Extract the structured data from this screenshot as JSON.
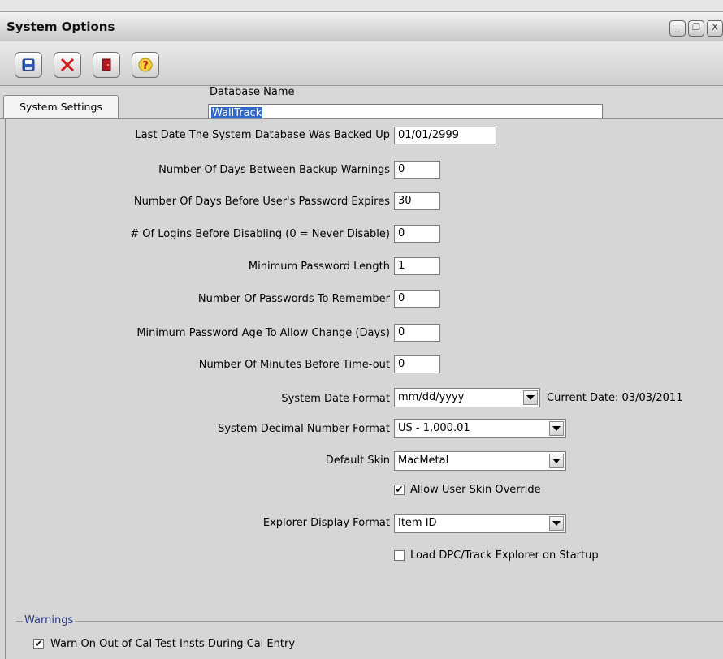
{
  "window": {
    "title": "System Options",
    "controls": [
      "_",
      "❐",
      "X"
    ]
  },
  "toolbar": {
    "buttons": [
      {
        "name": "save",
        "icon": "save-icon"
      },
      {
        "name": "cancel",
        "icon": "close-icon"
      },
      {
        "name": "exit",
        "icon": "door-exit-icon"
      },
      {
        "name": "help",
        "icon": "help-icon"
      }
    ],
    "database_name_label": "Database Name",
    "database_name_value": "WallTrack"
  },
  "tabs": [
    {
      "label": "System Settings",
      "selected": true
    }
  ],
  "settings": {
    "last_backup": {
      "label": "Last Date The System Database Was Backed Up",
      "value": "01/01/2999"
    },
    "backup_warning_days": {
      "label": "Number Of Days Between Backup Warnings",
      "value": "0"
    },
    "password_expire_days": {
      "label": "Number Of Days Before User's Password Expires",
      "value": "30"
    },
    "logins_before_disable": {
      "label": "# Of Logins Before Disabling (0 = Never Disable)",
      "value": "0"
    },
    "min_password_length": {
      "label": "Minimum Password Length",
      "value": "1"
    },
    "passwords_remember": {
      "label": "Number Of Passwords To Remember",
      "value": "0"
    },
    "min_password_age": {
      "label": "Minimum Password Age To Allow Change (Days)",
      "value": "0"
    },
    "timeout_minutes": {
      "label": "Number Of Minutes Before Time-out",
      "value": "0"
    },
    "date_format": {
      "label": "System Date Format",
      "value": "mm/dd/yyyy",
      "current_date": "Current Date: 03/03/2011"
    },
    "decimal_format": {
      "label": "System Decimal Number Format",
      "value": "US - 1,000.01"
    },
    "default_skin": {
      "label": "Default Skin",
      "value": "MacMetal"
    },
    "allow_skin_override": {
      "label": "Allow User Skin Override",
      "checked": true
    },
    "explorer_display": {
      "label": "Explorer Display Format",
      "value": "Item ID"
    },
    "load_explorer_startup": {
      "label": "Load DPC/Track Explorer on Startup",
      "checked": false
    }
  },
  "warnings": {
    "title": "Warnings",
    "warn_out_of_cal": {
      "label": "Warn On Out of Cal Test Insts During Cal Entry",
      "checked": true
    }
  },
  "colors": {
    "accent_selection": "#3168c8",
    "group_title": "#2a3a8c"
  }
}
